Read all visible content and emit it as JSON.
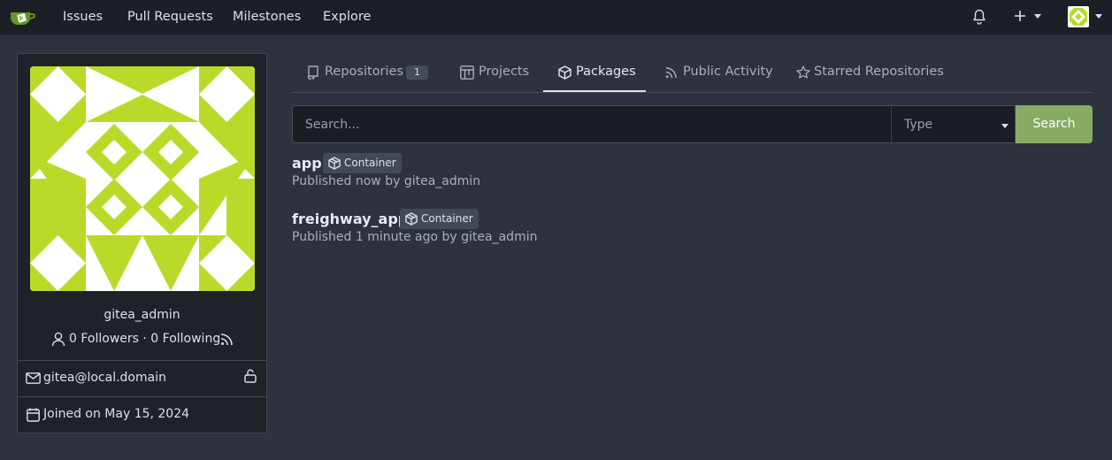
{
  "nav": {
    "items": [
      "Issues",
      "Pull Requests",
      "Milestones",
      "Explore"
    ]
  },
  "profile": {
    "username": "gitea_admin",
    "follow_text": "0 Followers · 0 Following",
    "email": "gitea@local.domain",
    "joined": "Joined on May 15, 2024"
  },
  "tabs": [
    {
      "label": "Repositories",
      "badge": "1"
    },
    {
      "label": "Projects"
    },
    {
      "label": "Packages"
    },
    {
      "label": "Public Activity"
    },
    {
      "label": "Starred Repositories"
    }
  ],
  "search": {
    "placeholder": "Search...",
    "type_placeholder": "Type",
    "button_label": "Search"
  },
  "packages": [
    {
      "name": "app",
      "type": "Container",
      "meta": "Published now by gitea_admin"
    },
    {
      "name": "freighway_app",
      "type": "Container",
      "meta": "Published 1 minute ago by gitea_admin"
    }
  ],
  "colors": {
    "accent": "#87ab63",
    "avatar": "#bada2a"
  }
}
